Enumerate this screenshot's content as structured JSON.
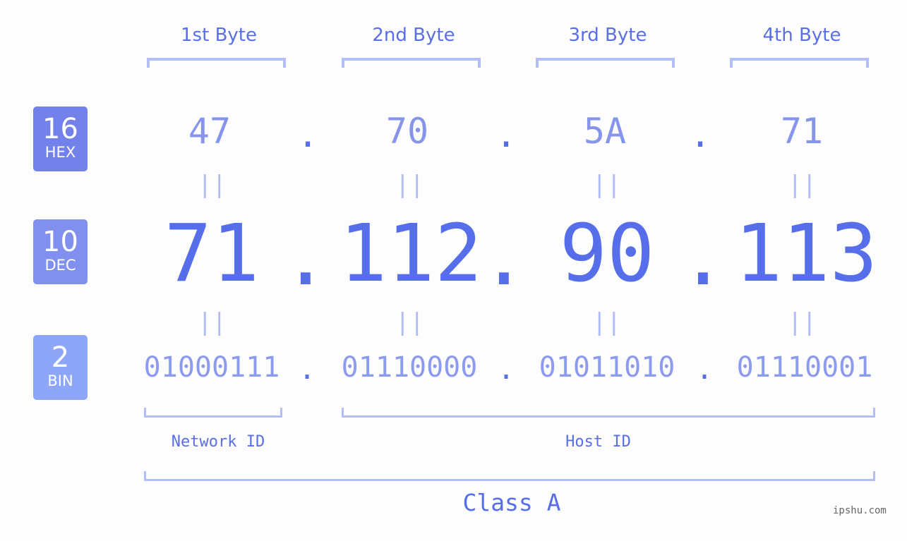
{
  "colors": {
    "hex_badge": "#7282ea",
    "dec_badge": "#8190ef",
    "bin_badge": "#8ea6f7",
    "accent": "#566ee9",
    "bracket": "#b3bdf7"
  },
  "bases": [
    {
      "number": "16",
      "label": "HEX"
    },
    {
      "number": "10",
      "label": "DEC"
    },
    {
      "number": "2",
      "label": "BIN"
    }
  ],
  "byte_headers": [
    "1st Byte",
    "2nd Byte",
    "3rd Byte",
    "4th Byte"
  ],
  "hex": [
    "47",
    "70",
    "5A",
    "71"
  ],
  "dec": [
    "71",
    "112",
    "90",
    "113"
  ],
  "bin": [
    "01000111",
    "01110000",
    "01011010",
    "01110001"
  ],
  "separator": ".",
  "equals": "||",
  "network_label": "Network ID",
  "host_label": "Host ID",
  "class_label": "Class A",
  "watermark": "ipshu.com"
}
